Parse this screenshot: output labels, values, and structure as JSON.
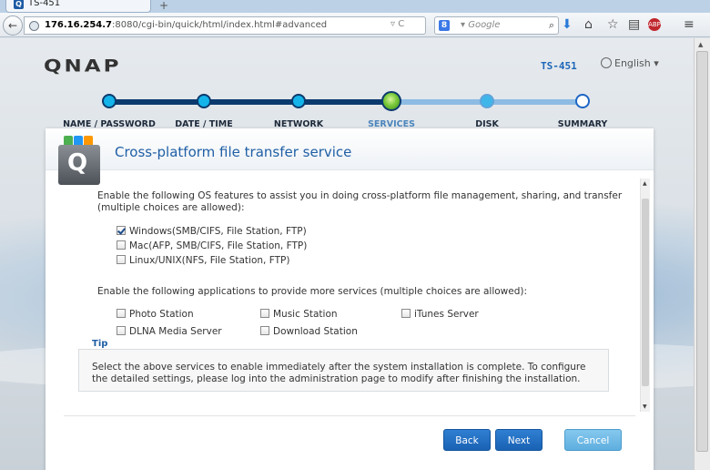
{
  "browser": {
    "tab_title": "TS-451",
    "tab_icon_glyph": "Q",
    "new_tab_glyph": "+",
    "back_glyph": "←",
    "url_host": "176.16.254.7",
    "url_path": ":8080/cgi-bin/quick/html/index.html#advanced",
    "url_controls": "▿ C",
    "search_engine_glyph": "8",
    "search_placeholder": "▾ Google",
    "search_icon_glyph": "⌕",
    "toolbar_glyphs": [
      "⬇",
      "⌂",
      "☆",
      "▤",
      "ABP",
      "≡"
    ]
  },
  "header": {
    "logo": "QNAP",
    "model": "TS-451",
    "language": "English ▾"
  },
  "steps": [
    {
      "label": "NAME / PASSWORD",
      "state": "done"
    },
    {
      "label": "DATE / TIME",
      "state": "done"
    },
    {
      "label": "NETWORK",
      "state": "done"
    },
    {
      "label": "SERVICES",
      "state": "current"
    },
    {
      "label": "DISK",
      "state": "todo"
    },
    {
      "label": "SUMMARY",
      "state": "todo"
    }
  ],
  "panel": {
    "icon_letter": "Q",
    "title": "Cross-platform file transfer service",
    "intro": "Enable the following OS features to assist you in doing cross-platform file management, sharing, and transfer (multiple choices are allowed):",
    "os_features": [
      {
        "label": "Windows(SMB/CIFS, File Station, FTP)",
        "checked": true
      },
      {
        "label": "Mac(AFP, SMB/CIFS, File Station, FTP)",
        "checked": false
      },
      {
        "label": "Linux/UNIX(NFS, File Station, FTP)",
        "checked": false
      }
    ],
    "apps_intro": "Enable the following applications to provide more services (multiple choices are allowed):",
    "apps": [
      {
        "label": "Photo Station",
        "checked": false
      },
      {
        "label": "Music Station",
        "checked": false
      },
      {
        "label": "iTunes Server",
        "checked": false
      },
      {
        "label": "DLNA Media Server",
        "checked": false
      },
      {
        "label": "Download Station",
        "checked": false
      }
    ],
    "tip_label": "Tip",
    "tip_text": "Select the above services to enable immediately after the system installation is complete. To configure the detailed settings, please log into the administration page to modify after finishing the installation.",
    "buttons": {
      "back": "Back",
      "next": "Next",
      "cancel": "Cancel"
    }
  },
  "colors": {
    "accent": "#1f5fa5",
    "primary_button": "#1a62b4",
    "cancel_button": "#5eaedf",
    "progress_done": "#0b3a6e",
    "progress_todo": "#8dbbe3"
  }
}
